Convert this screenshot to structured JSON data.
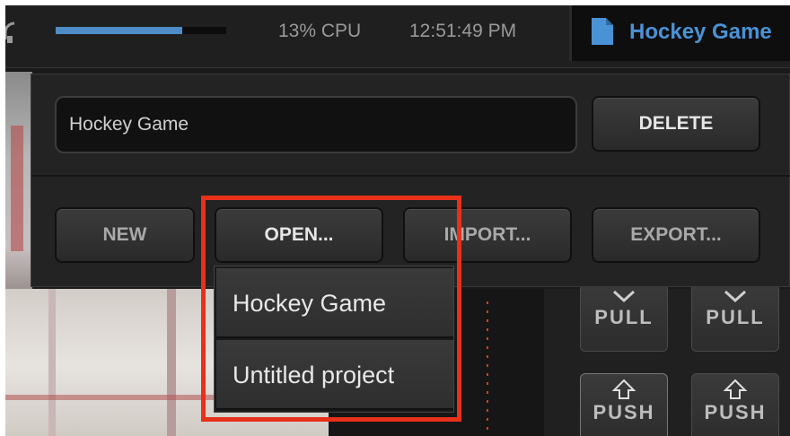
{
  "status_bar": {
    "cpu_usage_percent": 74,
    "cpu_text": "13% CPU",
    "clock": "12:51:49 PM",
    "active_project_tab": "Hockey Game",
    "accent_color": "#4a92d6"
  },
  "project_panel": {
    "name_field_value": "Hockey Game",
    "delete_label": "DELETE",
    "new_label": "NEW",
    "open_label": "OPEN...",
    "import_label": "IMPORT...",
    "export_label": "EXPORT..."
  },
  "open_dropdown": {
    "items": [
      {
        "label": "Hockey Game"
      },
      {
        "label": "Untitled project"
      }
    ]
  },
  "transition_buttons": {
    "pull_1": "PULL",
    "pull_2": "PULL",
    "push_1": "PUSH",
    "push_2": "PUSH"
  },
  "icons": [
    "headphone-icon",
    "document-icon",
    "chevron-down-icon",
    "arrow-up-icon"
  ],
  "highlight_color": "#e8301a"
}
